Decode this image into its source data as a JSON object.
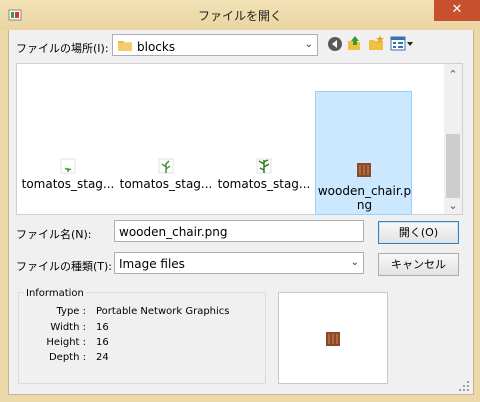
{
  "window": {
    "title": "ファイルを開く",
    "close_glyph": "✕"
  },
  "look_in": {
    "label": "ファイルの場所(I):",
    "value": "blocks"
  },
  "files": [
    {
      "name": "tomatos_stag..."
    },
    {
      "name": "tomatos_stag..."
    },
    {
      "name": "tomatos_stag..."
    },
    {
      "name": "wooden_chair.png"
    }
  ],
  "filename": {
    "label": "ファイル名(N):",
    "value": "wooden_chair.png"
  },
  "filetype": {
    "label": "ファイルの種類(T):",
    "value": "Image files"
  },
  "buttons": {
    "open": "開く(O)",
    "cancel": "キャンセル"
  },
  "info": {
    "heading": "Information",
    "rows": [
      {
        "key": "Type :",
        "value": "Portable Network Graphics"
      },
      {
        "key": "Width :",
        "value": "16"
      },
      {
        "key": "Height :",
        "value": "16"
      },
      {
        "key": "Depth :",
        "value": "24"
      }
    ]
  },
  "scroll_up_glyph": "⌃",
  "scroll_down_glyph": "⌄",
  "combo_arrow_glyph": "⌄"
}
